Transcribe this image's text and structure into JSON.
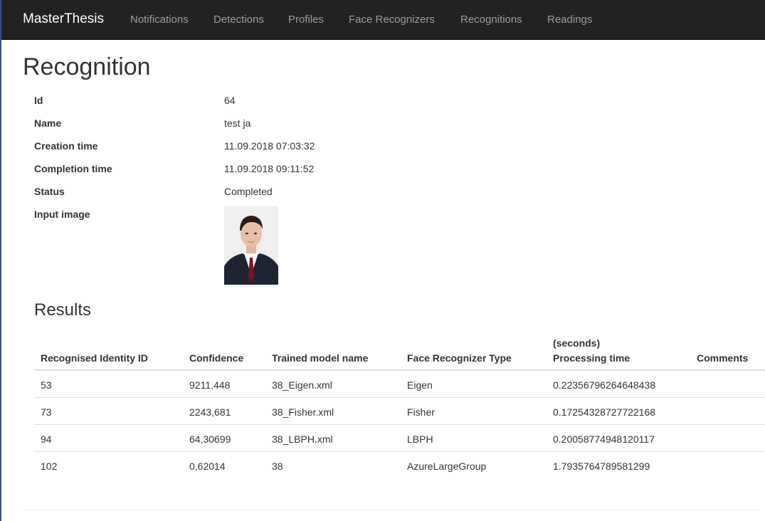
{
  "navbar": {
    "brand": "MasterThesis",
    "items": [
      "Notifications",
      "Detections",
      "Profiles",
      "Face Recognizers",
      "Recognitions",
      "Readings"
    ]
  },
  "page": {
    "title": "Recognition"
  },
  "details": {
    "id_label": "Id",
    "id_value": "64",
    "name_label": "Name",
    "name_value": "test ja",
    "creation_label": "Creation time",
    "creation_value": "11.09.2018 07:03:32",
    "completion_label": "Completion time",
    "completion_value": "11.09.2018 09:11:52",
    "status_label": "Status",
    "status_value": "Completed",
    "image_label": "Input image"
  },
  "results": {
    "title": "Results",
    "headers": {
      "identity": "Recognised Identity ID",
      "confidence": "Confidence",
      "model": "Trained model name",
      "type": "Face Recognizer Type",
      "time_unit": "(seconds)",
      "time": "Processing time",
      "comments": "Comments"
    },
    "rows": [
      {
        "identity": "53",
        "confidence": "9211,448",
        "model": "38_Eigen.xml",
        "type": "Eigen",
        "time": "0.22356796264648438",
        "comments": ""
      },
      {
        "identity": "73",
        "confidence": "2243,681",
        "model": "38_Fisher.xml",
        "type": "Fisher",
        "time": "0.17254328727722168",
        "comments": ""
      },
      {
        "identity": "94",
        "confidence": "64,30699",
        "model": "38_LBPH.xml",
        "type": "LBPH",
        "time": "0.20058774948120117",
        "comments": ""
      },
      {
        "identity": "102",
        "confidence": "0,62014",
        "model": "38",
        "type": "AzureLargeGroup",
        "time": "1.7935764789581299",
        "comments": ""
      }
    ]
  },
  "colors": {
    "navbar_bg": "#222222",
    "nav_text": "#9d9d9d",
    "brand_text": "#ffffff",
    "body_text": "#333333"
  }
}
